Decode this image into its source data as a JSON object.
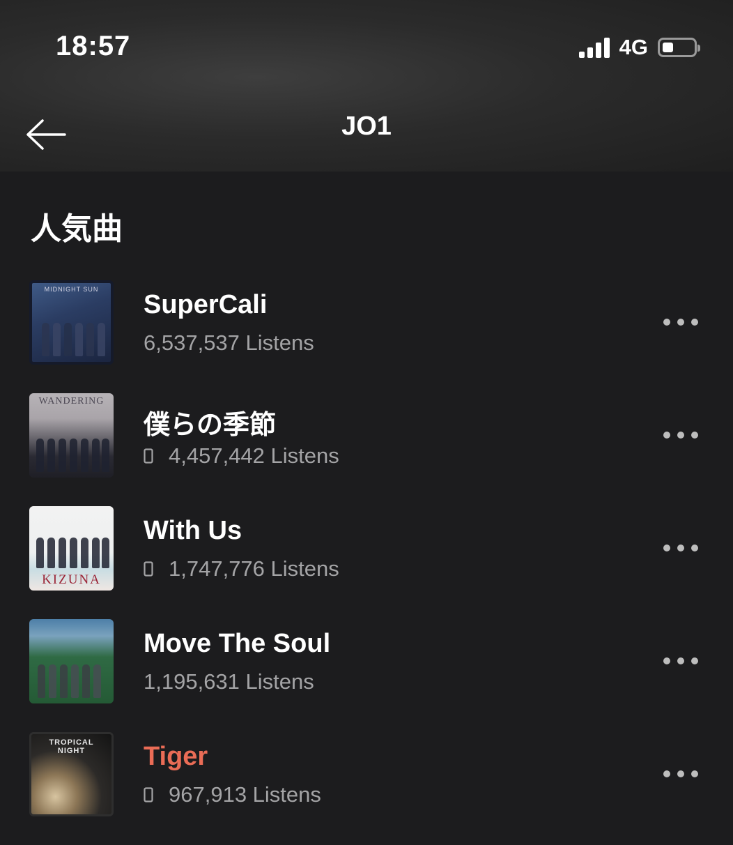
{
  "status_bar": {
    "time": "18:57",
    "network": "4G",
    "battery_level": 0.35
  },
  "nav": {
    "title": "JO1",
    "back_icon": "arrow-left-icon"
  },
  "section": {
    "title": "人気曲"
  },
  "tracks": [
    {
      "title": "SuperCali",
      "listens": "6,537,537 Listens",
      "device_icon": false,
      "playing": false,
      "cover_caption": "MIDNIGHT SUN"
    },
    {
      "title": "僕らの季節",
      "listens": "4,457,442 Listens",
      "device_icon": true,
      "playing": false,
      "cover_caption": "WANDERING"
    },
    {
      "title": "With Us",
      "listens": "1,747,776 Listens",
      "device_icon": true,
      "playing": false,
      "cover_caption": "KIZUNA"
    },
    {
      "title": "Move The Soul",
      "listens": "1,195,631 Listens",
      "device_icon": false,
      "playing": false,
      "cover_caption": ""
    },
    {
      "title": "Tiger",
      "listens": "967,913 Listens",
      "device_icon": true,
      "playing": true,
      "cover_caption": "TROPICAL NIGHT"
    }
  ],
  "colors": {
    "background": "#1c1c1e",
    "accent": "#ea6c56",
    "secondary_text": "#a4a4a6"
  }
}
